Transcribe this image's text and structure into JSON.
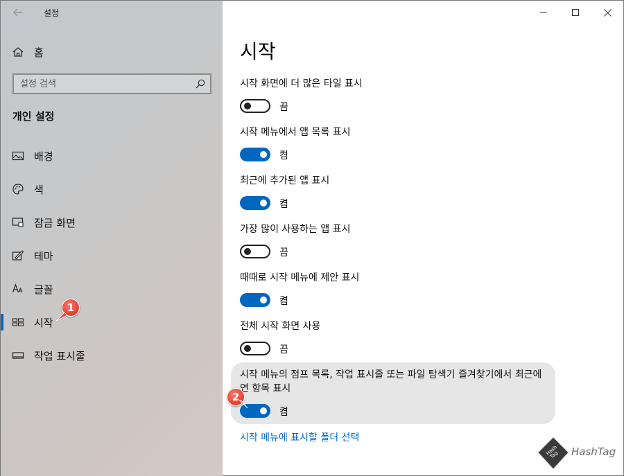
{
  "window": {
    "title": "설정"
  },
  "sidebar": {
    "home_label": "홈",
    "search_placeholder": "설정 검색",
    "section_title": "개인 설정",
    "items": [
      {
        "label": "배경",
        "icon": "picture-icon"
      },
      {
        "label": "색",
        "icon": "palette-icon"
      },
      {
        "label": "잠금 화면",
        "icon": "lock-screen-icon"
      },
      {
        "label": "테마",
        "icon": "theme-icon"
      },
      {
        "label": "글꼴",
        "icon": "font-icon"
      },
      {
        "label": "시작",
        "icon": "start-icon",
        "active": true
      },
      {
        "label": "작업 표시줄",
        "icon": "taskbar-icon"
      }
    ]
  },
  "main": {
    "title": "시작",
    "settings": [
      {
        "label": "시작 화면에 더 많은 타일 표시",
        "state": "끔",
        "on": false
      },
      {
        "label": "시작 메뉴에서 앱 목록 표시",
        "state": "켬",
        "on": true
      },
      {
        "label": "최근에 추가된 앱 표시",
        "state": "켬",
        "on": true
      },
      {
        "label": "가장 많이 사용하는 앱 표시",
        "state": "끔",
        "on": false
      },
      {
        "label": "때때로 시작 메뉴에 제안 표시",
        "state": "켬",
        "on": true
      },
      {
        "label": "전체 시작 화면 사용",
        "state": "끔",
        "on": false
      },
      {
        "label": "시작 메뉴의 점프 목록, 작업 표시줄 또는 파일 탐색기 즐겨찾기에서 최근에 연 항목 표시",
        "state": "켬",
        "on": true
      }
    ],
    "link": "시작 메뉴에 표시할 폴더 선택"
  },
  "annotations": {
    "badge1": "1",
    "badge2": "2"
  },
  "watermark": {
    "text": "HashTag",
    "logo_text": "Hash Tag"
  },
  "colors": {
    "accent": "#0067c0",
    "badge": "#e84a3a"
  }
}
